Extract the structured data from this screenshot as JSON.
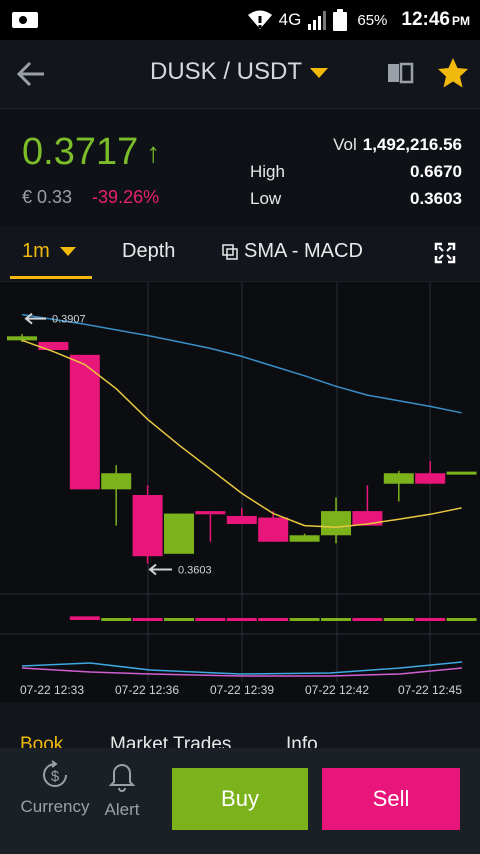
{
  "status": {
    "network": "4G",
    "battery": "65%",
    "time": "12:46",
    "ampm": "PM"
  },
  "header": {
    "title": "DUSK / USDT",
    "icons": [
      "back-arrow-icon",
      "book-icon",
      "star-icon"
    ],
    "star_color": "#f0b90b"
  },
  "ticker": {
    "price": "0.3717",
    "direction_arrow": "↑",
    "eur": "€ 0.33",
    "change": "-39.26%",
    "vol_label": "Vol",
    "vol": "1,492,216.56",
    "high_label": "High",
    "high": "0.6670",
    "low_label": "Low",
    "low": "0.3603"
  },
  "tabs": {
    "interval": "1m",
    "depth": "Depth",
    "indicators": "SMA - MACD"
  },
  "chart_data": {
    "type": "candlestick",
    "x_ticks": [
      "07-22 12:33",
      "07-22 12:36",
      "07-22 12:39",
      "07-22 12:42",
      "07-22 12:45"
    ],
    "annotations": {
      "high_marker": "0.3907",
      "low_marker": "0.3603"
    },
    "colors": {
      "up": "#7cb21c",
      "down": "#e8167a",
      "sma_fast": "#e8c840",
      "sma_slow": "#3a8fc8"
    },
    "candles": [
      {
        "o": 0.3885,
        "c": 0.388,
        "h": 0.3888,
        "l": 0.3878,
        "dir": "up"
      },
      {
        "o": 0.3878,
        "c": 0.3868,
        "h": 0.3878,
        "l": 0.3868,
        "dir": "down"
      },
      {
        "o": 0.3862,
        "c": 0.3695,
        "h": 0.3862,
        "l": 0.3695,
        "dir": "down"
      },
      {
        "o": 0.3695,
        "c": 0.3715,
        "h": 0.3725,
        "l": 0.365,
        "dir": "up"
      },
      {
        "o": 0.3688,
        "c": 0.3612,
        "h": 0.37,
        "l": 0.3603,
        "dir": "down"
      },
      {
        "o": 0.3615,
        "c": 0.3665,
        "h": 0.3665,
        "l": 0.3615,
        "dir": "up"
      },
      {
        "o": 0.3668,
        "c": 0.3664,
        "h": 0.3668,
        "l": 0.363,
        "dir": "down"
      },
      {
        "o": 0.3662,
        "c": 0.3652,
        "h": 0.3672,
        "l": 0.3652,
        "dir": "down"
      },
      {
        "o": 0.366,
        "c": 0.363,
        "h": 0.3668,
        "l": 0.363,
        "dir": "down"
      },
      {
        "o": 0.363,
        "c": 0.3638,
        "h": 0.364,
        "l": 0.363,
        "dir": "up"
      },
      {
        "o": 0.3638,
        "c": 0.3668,
        "h": 0.3685,
        "l": 0.3628,
        "dir": "up"
      },
      {
        "o": 0.3668,
        "c": 0.365,
        "h": 0.37,
        "l": 0.365,
        "dir": "down"
      },
      {
        "o": 0.3702,
        "c": 0.3715,
        "h": 0.3718,
        "l": 0.368,
        "dir": "up"
      },
      {
        "o": 0.3715,
        "c": 0.3702,
        "h": 0.373,
        "l": 0.3702,
        "dir": "down"
      },
      {
        "o": 0.3715,
        "c": 0.3717,
        "h": 0.3717,
        "l": 0.3715,
        "dir": "up"
      }
    ],
    "sma_fast": [
      0.388,
      0.3866,
      0.385,
      0.382,
      0.3782,
      0.375,
      0.372,
      0.369,
      0.3665,
      0.365,
      0.3648,
      0.3652,
      0.3658,
      0.3664,
      0.3672
    ],
    "sma_slow": [
      0.3912,
      0.3906,
      0.39,
      0.3893,
      0.3886,
      0.3878,
      0.387,
      0.386,
      0.3848,
      0.3836,
      0.3823,
      0.3812,
      0.3805,
      0.3798,
      0.379
    ],
    "y_range": [
      0.358,
      0.394
    ]
  },
  "bottom_tabs": {
    "book": "Book",
    "trades": "Market Trades",
    "info": "Info"
  },
  "actions": {
    "currency": "Currency",
    "alert": "Alert",
    "buy": "Buy",
    "sell": "Sell"
  }
}
